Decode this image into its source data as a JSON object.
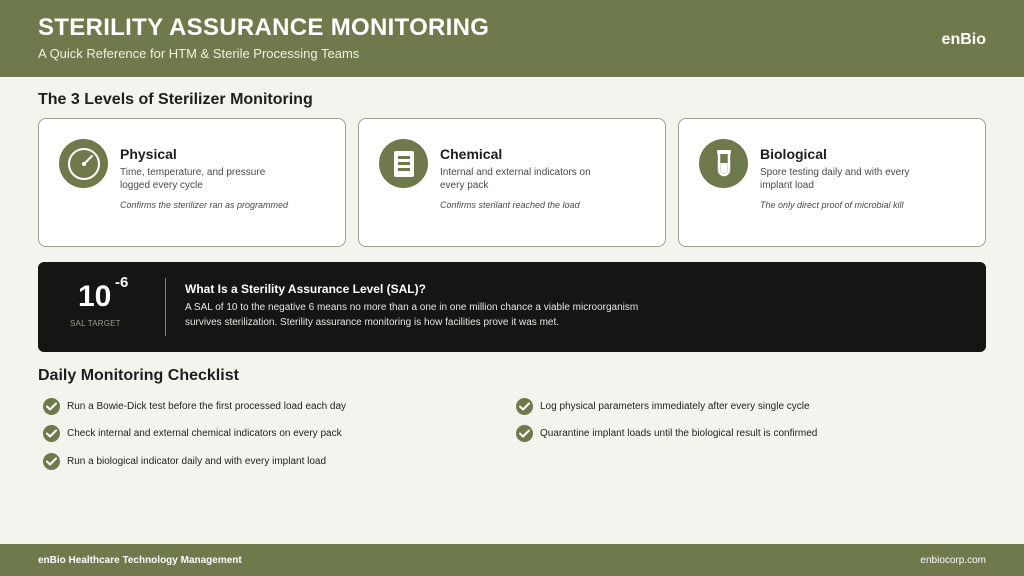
{
  "header": {
    "title": "STERILITY ASSURANCE MONITORING",
    "subtitle": "A Quick Reference for HTM & Sterile Processing Teams",
    "brand": "enBio"
  },
  "levels": {
    "heading": "The 3 Levels of Sterilizer Monitoring",
    "cards": [
      {
        "icon": "gauge-icon",
        "title": "Physical",
        "description": "Time, temperature, and pressure logged every cycle",
        "note": "Confirms the sterilizer ran as programmed"
      },
      {
        "icon": "indicator-strip-icon",
        "title": "Chemical",
        "description": "Internal and external indicators on every pack",
        "note": "Confirms sterilant reached the load"
      },
      {
        "icon": "test-tube-icon",
        "title": "Biological",
        "description": "Spore testing daily and with every implant load",
        "note": "The only direct proof of microbial kill"
      }
    ]
  },
  "sal": {
    "value": "10",
    "exponent": "-6",
    "label": "SAL TARGET",
    "title": "What Is a Sterility Assurance Level (SAL)?",
    "body": "A SAL of 10 to the negative 6 means no more than a one in one million chance a viable microorganism survives sterilization. Sterility assurance monitoring is how facilities prove it was met."
  },
  "checklist": {
    "heading": "Daily Monitoring Checklist",
    "items": [
      "Run a Bowie-Dick test before the first processed load each day",
      "Check internal and external chemical indicators on every pack",
      "Run a biological indicator daily and with every implant load",
      "Log physical parameters immediately after every single cycle",
      "Quarantine implant loads until the biological result is confirmed"
    ]
  },
  "footer": {
    "left": "enBio Healthcare Technology Management",
    "right": "enbiocorp.com"
  },
  "colors": {
    "accent": "#6e7a4b",
    "dark": "#151513",
    "background": "#f4f4ef"
  }
}
